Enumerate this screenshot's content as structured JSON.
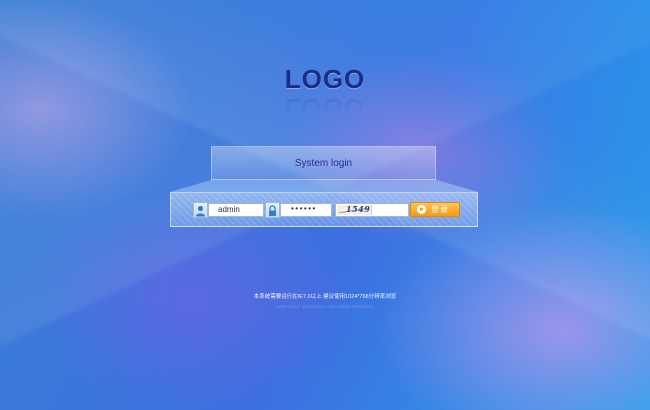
{
  "logo": {
    "text": "LOGO"
  },
  "panel": {
    "title": "System login"
  },
  "username": {
    "value": "admin",
    "icon": "user-icon"
  },
  "password": {
    "masked_value": "••••••",
    "icon": "lock-icon"
  },
  "captcha": {
    "code": "1549",
    "input_value": ""
  },
  "login_button": {
    "label": "登录",
    "icon": "login-arrow-icon"
  },
  "footer": {
    "line1": "本系统需要运行在IE7.0以上  建议使用1024*768分辨率浏览",
    "line2": "COPY RIGHT @2009-2019 ***ALL RIGHT RESERVED"
  },
  "colors": {
    "accent": "#f59a10",
    "title": "#24328a",
    "logo": "#1b2e86"
  }
}
